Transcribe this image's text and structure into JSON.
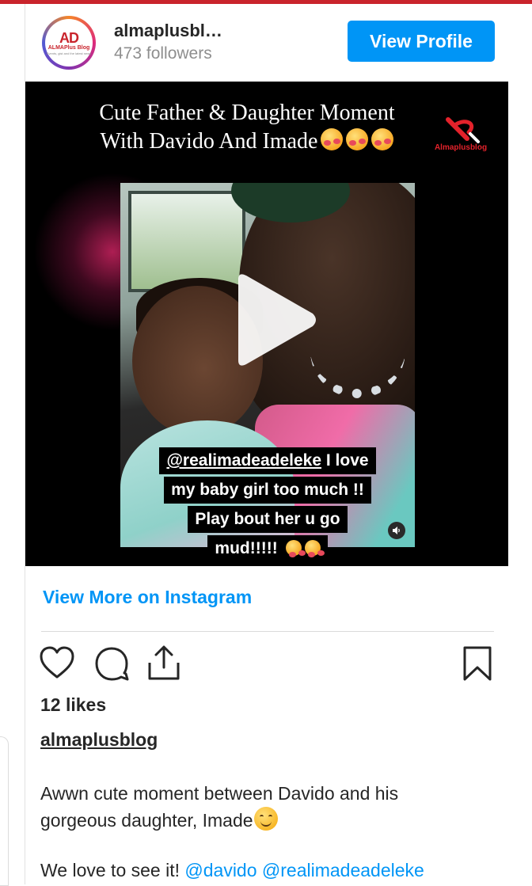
{
  "profile": {
    "username": "almaplusbl…",
    "followers": "473 followers",
    "view_profile_label": "View Profile",
    "avatar_logo": "AD",
    "avatar_name": "ALMAPlus Blog",
    "avatar_tagline": "Events, gist and the latest news"
  },
  "video": {
    "title_line1": "Cute Father & Daughter Moment",
    "title_line2": "With Davido And Imade",
    "brand_label": "Almaplusblog",
    "caption_mention": "@realimadeadeleke",
    "caption_line1_rest": " I love",
    "caption_line2": "my baby girl too much !!",
    "caption_line3": "Play bout her u go",
    "caption_line4": "mud!!!!!"
  },
  "links": {
    "view_more": "View More on Instagram"
  },
  "post": {
    "likes": "12 likes",
    "author": "almaplusblog",
    "caption_line1": "Awwn cute moment between Davido and his",
    "caption_line2": "gorgeous daughter, Imade",
    "caption2_prefix": "We love to see it! ",
    "mention1": "@davido",
    "mention2": "@realimadeadeleke"
  },
  "icons": [
    "heart-icon",
    "comment-icon",
    "share-icon",
    "bookmark-icon",
    "play-icon",
    "sound-icon"
  ],
  "colors": {
    "accent_blue": "#0095f6",
    "top_strip": "#c9242c",
    "text": "#262626",
    "muted": "#8e8e8e"
  }
}
